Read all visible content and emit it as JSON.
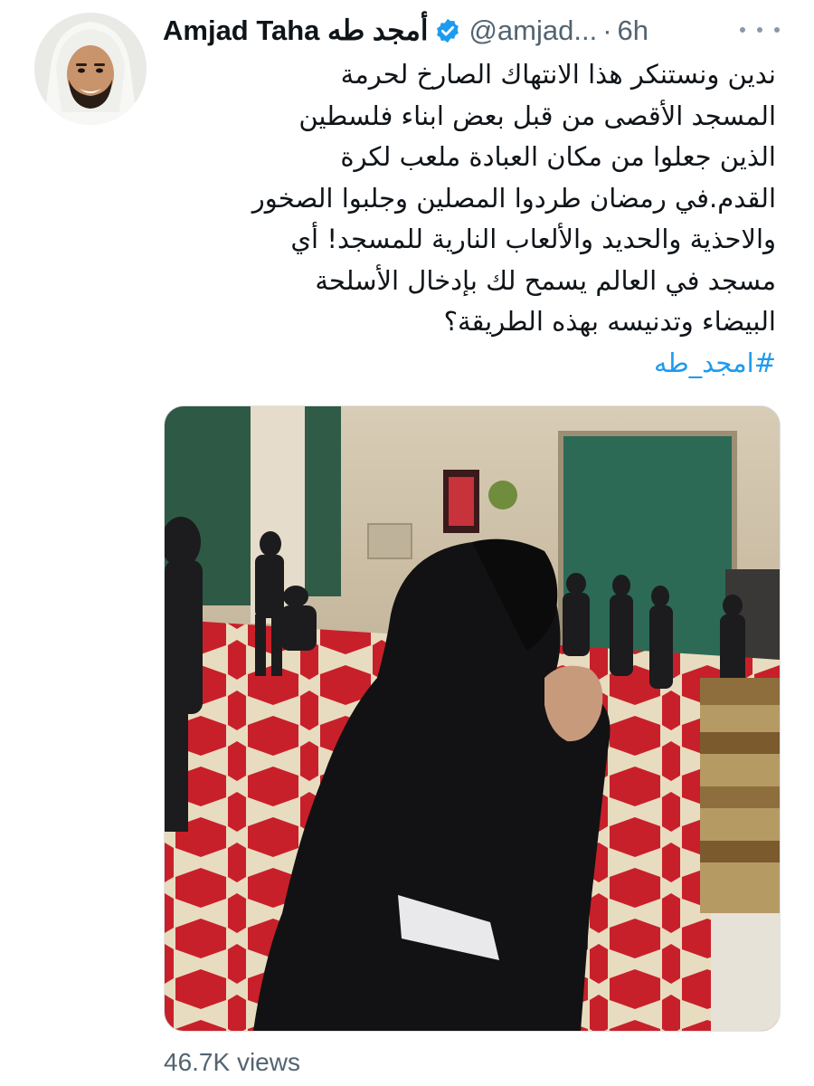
{
  "tweet": {
    "author": {
      "name": "Amjad Taha أمجد طه",
      "handle": "@amjad...",
      "verified": true,
      "avatar_icon": "profile-photo"
    },
    "separator": "·",
    "time": "6h",
    "more_icon": "more-horizontal-icon",
    "text_lines": [
      "ندين ونستنكر هذا الانتهاك الصارخ لحرمة",
      "المسجد الأقصى من قبل بعض ابناء فلسطين",
      "الذين جعلوا من مكان العبادة ملعب لكرة",
      "القدم.في رمضان طردوا المصلين وجلبوا الصخور",
      "والاحذية والحديد والألعاب النارية للمسجد! أي",
      "مسجد في العالم يسمح لك بإدخال الأسلحة",
      "البيضاء وتدنيسه بهذه الطريقة؟"
    ],
    "hashtag": "#امجد_طه",
    "media": {
      "type": "video-still"
    },
    "views": "46.7K views"
  },
  "colors": {
    "text": "#0f1419",
    "secondary": "#536471",
    "link": "#1d9bf0",
    "verified": "#1d9bf0"
  }
}
